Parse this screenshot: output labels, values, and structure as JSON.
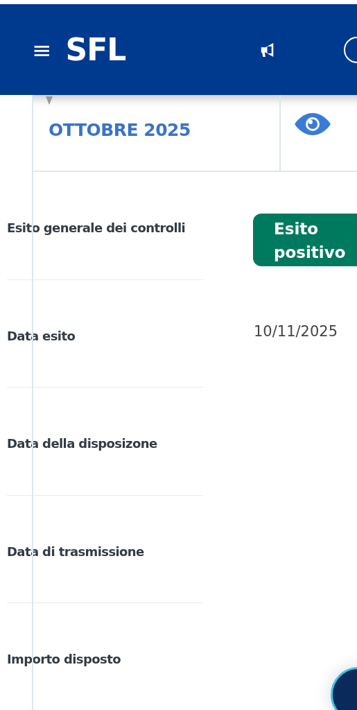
{
  "header": {
    "menu_icon": "≡",
    "logo": "SFL"
  },
  "period": {
    "label": "OTTOBRE 2025"
  },
  "rows": [
    {
      "label": "Esito generale dei controlli",
      "kind": "badge",
      "value": "Esito positivo",
      "color": "#007a5e"
    },
    {
      "label": "Data esito",
      "kind": "text",
      "value": "10/11/2025"
    },
    {
      "label": "Data della disposizone",
      "kind": "empty"
    },
    {
      "label": "Data di trasmissione",
      "kind": "empty"
    },
    {
      "label": "Importo disposto",
      "kind": "empty"
    }
  ]
}
